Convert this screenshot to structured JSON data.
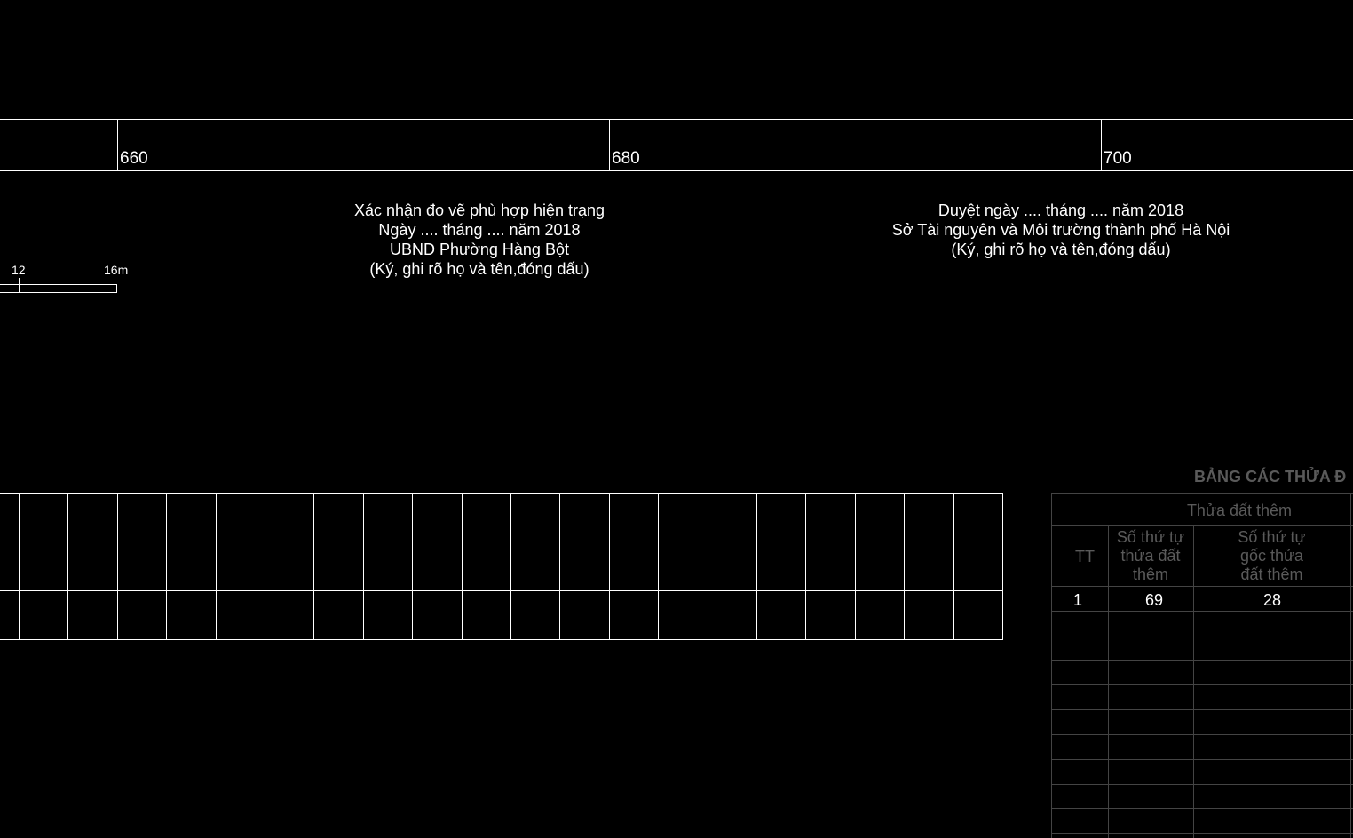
{
  "ruler": {
    "labels": [
      "660",
      "680",
      "700"
    ]
  },
  "scale_bar": {
    "labels": [
      "12",
      "16m"
    ]
  },
  "confirm_block": {
    "line1": "Xác nhận đo vẽ phù hợp hiện trạng",
    "line2": "Ngày .... tháng .... năm 2018",
    "line3": "UBND Phường Hàng Bột",
    "line4": "(Ký, ghi rõ họ và tên,đóng dấu)"
  },
  "approve_block": {
    "line1": "Duyệt ngày .... tháng .... năm 2018",
    "line2": "Sở Tài nguyên và Môi trường thành phố Hà Nội",
    "line3": "(Ký, ghi rõ họ và tên,đóng dấu)"
  },
  "parcel_table": {
    "title": "BẢNG CÁC THỬA Đ",
    "group_header": "Thửa đất thêm",
    "columns": [
      "TT",
      "Số thứ tự\nthửa đất\nthêm",
      "Số thứ tự\ngốc thửa\nđất thêm"
    ],
    "rows": [
      [
        "1",
        "69",
        "28"
      ]
    ]
  },
  "colors": {
    "background": "#000000",
    "line": "#ffffff",
    "dim_text": "#5a5a5a",
    "dim_line": "#444444"
  }
}
